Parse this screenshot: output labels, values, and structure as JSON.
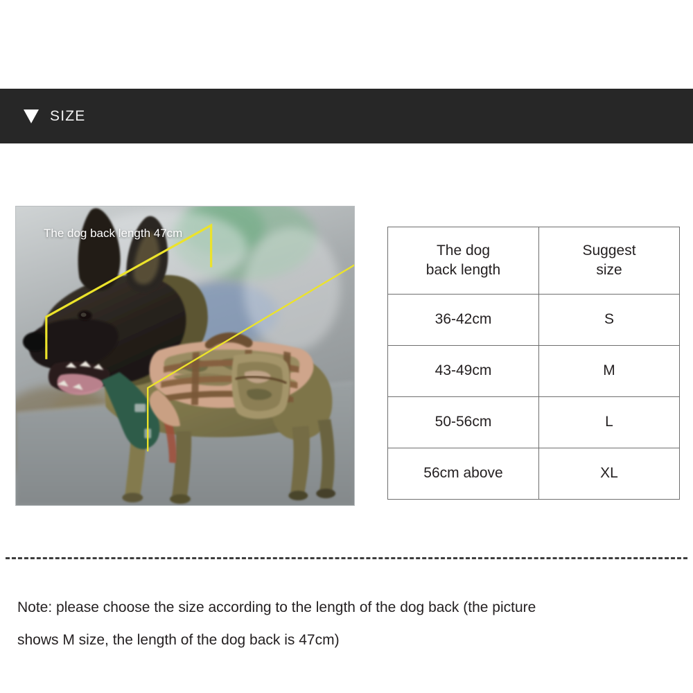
{
  "header": {
    "icon": "triangle-down-icon",
    "title": "SIZE",
    "bar_color": "#272727",
    "text_color": "#f2f2f2"
  },
  "photo": {
    "alt": "Belgian Malinois dog wearing a camouflage tactical harness with pouch",
    "caption": "The dog back length 47cm",
    "measurement_color": "#ece32a",
    "caption_color": "#ffffff"
  },
  "table": {
    "columns": [
      "The dog\nback length",
      "Suggest\nsize"
    ],
    "header": {
      "col1_line1": "The dog",
      "col1_line2": "back length",
      "col2_line1": "Suggest",
      "col2_line2": "size"
    },
    "rows": [
      {
        "length": "36-42cm",
        "size": "S"
      },
      {
        "length": "43-49cm",
        "size": "M"
      },
      {
        "length": "50-56cm",
        "size": "L"
      },
      {
        "length": "56cm above",
        "size": "XL"
      }
    ],
    "border_color": "#6e6e6e"
  },
  "note": {
    "line1": "Note: please choose the size according to the length of the dog back (the picture",
    "line2": "shows M size, the length of the dog back is 47cm)"
  },
  "divider": {
    "style": "dashed",
    "color": "#3d3d3d"
  }
}
